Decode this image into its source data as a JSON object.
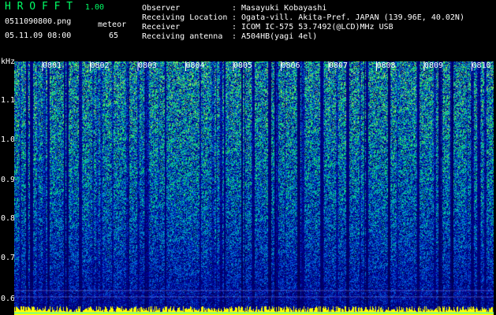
{
  "app": {
    "title": "H R O F F T",
    "version": "1.00"
  },
  "file": {
    "name": "0511090800.png",
    "datetime": "05.11.09 08:00"
  },
  "meteor": {
    "label": "meteor",
    "count": "65"
  },
  "info": {
    "observer": {
      "label": "Observer",
      "sep": ":",
      "value": "Masayuki Kobayashi"
    },
    "location": {
      "label": "Receiving Location",
      "sep": ":",
      "value": "Ogata-vill. Akita-Pref. JAPAN (139.96E, 40.02N)"
    },
    "receiver": {
      "label": "Receiver",
      "sep": ":",
      "value": "ICOM IC-575 53.7492(@LCD)MHz USB"
    },
    "antenna": {
      "label": "Receiving antenna",
      "sep": ":",
      "value": "A504HB(yagi 4el)"
    }
  },
  "axis": {
    "unit": "kHz",
    "y_ticks": [
      "1.1",
      "1.0",
      "0.9",
      "0.8",
      "0.7",
      "0.6"
    ],
    "time_ticks": [
      "0801",
      "0802",
      "0803",
      "0804",
      "0805",
      "0806",
      "0807",
      "0808",
      "0809",
      "0810"
    ]
  },
  "colors": {
    "title": "#00ff66",
    "background": "#000000",
    "baseline": "#ffff00",
    "signal": "#00ffaa"
  }
}
